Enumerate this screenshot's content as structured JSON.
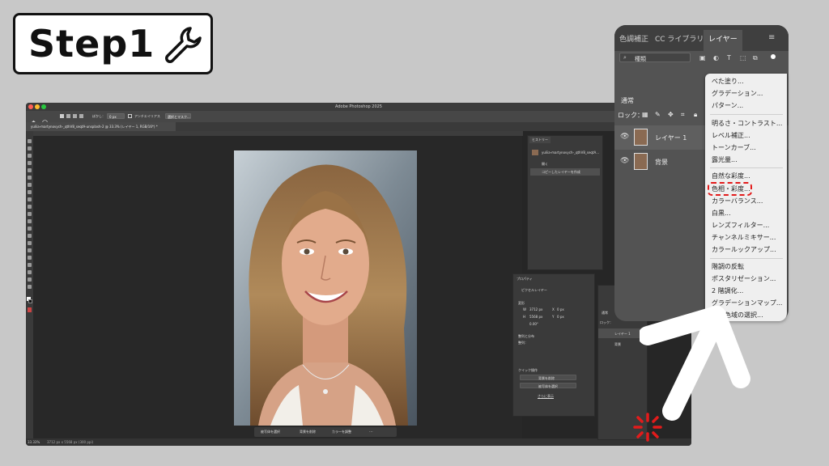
{
  "step_badge": {
    "label": "Step1",
    "icon": "wrench-icon"
  },
  "photoshop": {
    "window_title": "Adobe Photoshop 2025",
    "options_bar": {
      "feather_label": "ぼかし：",
      "feather_value": "0 px",
      "antialias_label": "アンチエイリアス",
      "select_mask_label": "選択とマスク..."
    },
    "document_tab": "yuliia-martynovych-_qthV8_seqtA-unsplash-2 @ 33.3% (レイヤー 1, RGB/16*) *",
    "status_bar": {
      "zoom": "33.33%",
      "dimensions": "3712 px x 5568 px (300 ppi)"
    },
    "context_bar": {
      "items": [
        "被写体を選択",
        "背景を削除",
        "カラーを調整"
      ]
    },
    "history_panel": {
      "tab": "ヒストリー",
      "snapshot": "yuliia-martynovych-_qthV8_seqtA...",
      "steps": [
        "開く",
        "コピーしたレイヤーを作成"
      ]
    },
    "properties_panel": {
      "tab": "プロパティ",
      "layer_type": "ピクセルレイヤー",
      "transform_title": "変形",
      "w_label": "W",
      "w_value": "3712 px",
      "h_label": "H",
      "h_value": "5568 px",
      "x_label": "X",
      "x_value": "0 px",
      "y_label": "Y",
      "y_value": "0 px",
      "angle_value": "0.00°",
      "align_title": "整列と分布",
      "align_label": "整列：",
      "quick_actions_title": "クイック操作",
      "quick_actions": [
        "背景を削除",
        "被写体を選択"
      ],
      "more_link": "さらに表示"
    },
    "mini_layers_panel": {
      "mode": "通常",
      "lock_label": "ロック：",
      "layers": [
        "レイヤー 1",
        "背景"
      ]
    }
  },
  "layers_zoom": {
    "tabs": [
      "色調補正",
      "CC ライブラリ",
      "レイヤー"
    ],
    "active_tab": "レイヤー",
    "search_placeholder": "種類",
    "blend_mode": "通常",
    "lock_label": "ロック：",
    "layers": [
      {
        "name": "レイヤー 1",
        "selected": true
      },
      {
        "name": "背景",
        "selected": false
      }
    ]
  },
  "adjustment_menu": {
    "groups": [
      [
        "べた塗り...",
        "グラデーション...",
        "パターン..."
      ],
      [
        "明るさ・コントラスト...",
        "レベル補正...",
        "トーンカーブ...",
        "露光量..."
      ],
      [
        "自然な彩度...",
        "色相・彩度...",
        "カラーバランス...",
        "白黒...",
        "レンズフィルター...",
        "チャンネルミキサー...",
        "カラールックアップ..."
      ],
      [
        "階調の反転",
        "ポスタリゼーション...",
        "2 階調化...",
        "グラデーションマップ...",
        "特定色域の選択..."
      ]
    ],
    "highlighted_item": "色相・彩度...",
    "highlight_color": "#e31b1b"
  },
  "colors": {
    "page_bg": "#c8c8c8",
    "ps_dark": "#262626",
    "panel": "#3a3a3a",
    "accent_red": "#e31b1b"
  }
}
